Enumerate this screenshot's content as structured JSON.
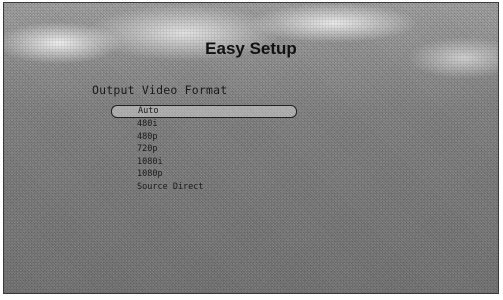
{
  "setup": {
    "title": "Easy Setup",
    "section": "Output Video Format",
    "options": [
      {
        "label": "Auto",
        "selected": true
      },
      {
        "label": "480i",
        "selected": false
      },
      {
        "label": "480p",
        "selected": false
      },
      {
        "label": "720p",
        "selected": false
      },
      {
        "label": "1080i",
        "selected": false
      },
      {
        "label": "1080p",
        "selected": false
      },
      {
        "label": "Source Direct",
        "selected": false
      }
    ]
  }
}
